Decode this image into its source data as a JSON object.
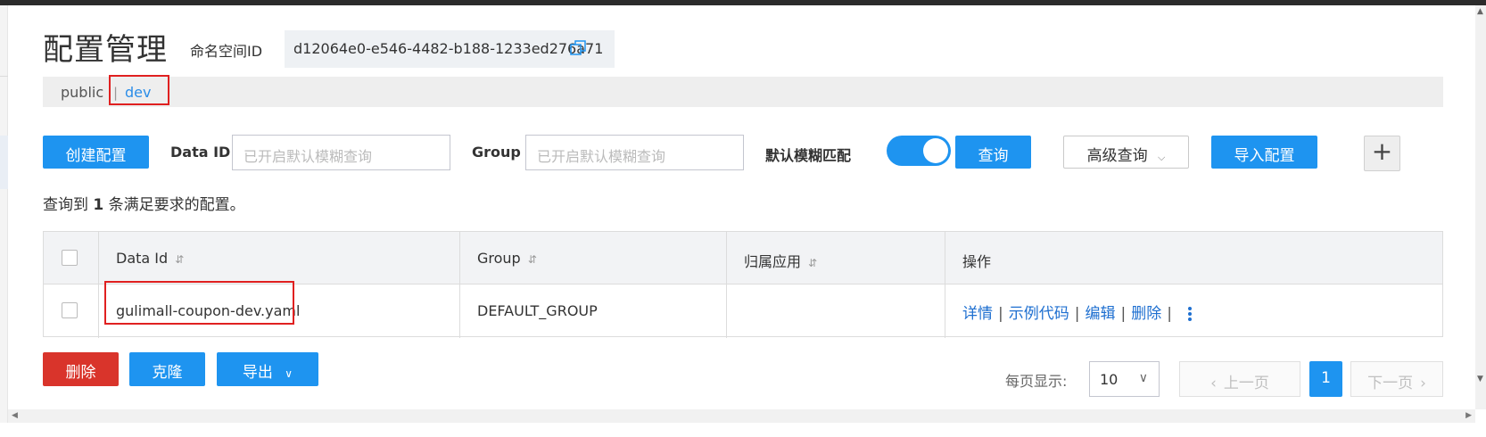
{
  "page": {
    "title": "配置管理",
    "namespace_label": "命名空间ID",
    "namespace_id": "d12064e0-e546-4482-b188-1233ed276a71"
  },
  "namespaces": {
    "items": [
      "public",
      "dev"
    ],
    "separator": "|",
    "active": "dev"
  },
  "toolbar": {
    "create_label": "创建配置",
    "dataid_label": "Data ID",
    "dataid_placeholder": "已开启默认模糊查询",
    "group_label": "Group",
    "group_placeholder": "已开启默认模糊查询",
    "fuzzy_label": "默认模糊匹配",
    "fuzzy_enabled": true,
    "query_label": "查询",
    "advanced_label": "高级查询",
    "import_label": "导入配置",
    "add_symbol": "+"
  },
  "result": {
    "prefix": "查询到",
    "count": "1",
    "suffix": "条满足要求的配置。"
  },
  "table": {
    "columns": [
      "Data Id",
      "Group",
      "归属应用",
      "操作"
    ],
    "sort_symbol": "⇵",
    "rows": [
      {
        "data_id": "gulimall-coupon-dev.yaml",
        "group": "DEFAULT_GROUP",
        "app": "",
        "actions": [
          "详情",
          "示例代码",
          "编辑",
          "删除"
        ]
      }
    ]
  },
  "bulk": {
    "delete_label": "删除",
    "clone_label": "克隆",
    "export_label": "导出"
  },
  "pagination": {
    "per_page_label": "每页显示:",
    "per_page_value": "10",
    "prev_label": "上一页",
    "current_page": "1",
    "next_label": "下一页"
  },
  "colors": {
    "primary": "#1e94f0",
    "danger": "#d9342b",
    "link": "#1e6fd0",
    "highlight_box": "#e02020"
  }
}
